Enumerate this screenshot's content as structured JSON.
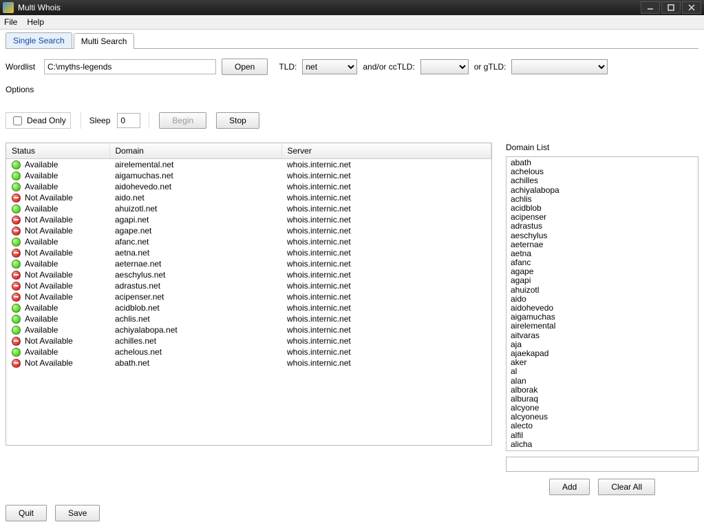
{
  "window": {
    "title": "Multi Whois"
  },
  "menu": {
    "file": "File",
    "help": "Help"
  },
  "tabs": {
    "single": "Single Search",
    "multi": "Multi Search"
  },
  "wordlist": {
    "label": "Wordlist",
    "value": "C:\\myths-legends",
    "open": "Open"
  },
  "tld": {
    "label": "TLD:",
    "value": "net",
    "cc_label": "and/or ccTLD:",
    "cc_value": "",
    "g_label": "or gTLD:",
    "g_value": ""
  },
  "options": {
    "label": "Options",
    "deadonly": "Dead Only",
    "sleep_label": "Sleep",
    "sleep_value": "0",
    "begin": "Begin",
    "stop": "Stop"
  },
  "columns": {
    "status": "Status",
    "domain": "Domain",
    "server": "Server"
  },
  "status_text": {
    "available": "Available",
    "not_available": "Not Available"
  },
  "results": [
    {
      "available": true,
      "domain": "airelemental.net",
      "server": "whois.internic.net"
    },
    {
      "available": true,
      "domain": "aigamuchas.net",
      "server": "whois.internic.net"
    },
    {
      "available": true,
      "domain": "aidohevedo.net",
      "server": "whois.internic.net"
    },
    {
      "available": false,
      "domain": "aido.net",
      "server": "whois.internic.net"
    },
    {
      "available": true,
      "domain": "ahuizotl.net",
      "server": "whois.internic.net"
    },
    {
      "available": false,
      "domain": "agapi.net",
      "server": "whois.internic.net"
    },
    {
      "available": false,
      "domain": "agape.net",
      "server": "whois.internic.net"
    },
    {
      "available": true,
      "domain": "afanc.net",
      "server": "whois.internic.net"
    },
    {
      "available": false,
      "domain": "aetna.net",
      "server": "whois.internic.net"
    },
    {
      "available": true,
      "domain": "aeternae.net",
      "server": "whois.internic.net"
    },
    {
      "available": false,
      "domain": "aeschylus.net",
      "server": "whois.internic.net"
    },
    {
      "available": false,
      "domain": "adrastus.net",
      "server": "whois.internic.net"
    },
    {
      "available": false,
      "domain": "acipenser.net",
      "server": "whois.internic.net"
    },
    {
      "available": true,
      "domain": "acidblob.net",
      "server": "whois.internic.net"
    },
    {
      "available": true,
      "domain": "achlis.net",
      "server": "whois.internic.net"
    },
    {
      "available": true,
      "domain": "achiyalabopa.net",
      "server": "whois.internic.net"
    },
    {
      "available": false,
      "domain": "achilles.net",
      "server": "whois.internic.net"
    },
    {
      "available": true,
      "domain": "achelous.net",
      "server": "whois.internic.net"
    },
    {
      "available": false,
      "domain": "abath.net",
      "server": "whois.internic.net"
    }
  ],
  "domain_list": {
    "label": "Domain List",
    "items": [
      "abath",
      "achelous",
      "achilles",
      "achiyalabopa",
      "achlis",
      "acidblob",
      "acipenser",
      "adrastus",
      "aeschylus",
      "aeternae",
      "aetna",
      "afanc",
      "agape",
      "agapi",
      "ahuizotl",
      "aido",
      "aidohevedo",
      "aigamuchas",
      "airelemental",
      "aitvaras",
      "aja",
      "ajaekapad",
      "aker",
      "al",
      "alan",
      "alborak",
      "alburaq",
      "alcyone",
      "alcyoneus",
      "alecto",
      "alfil",
      "alicha"
    ],
    "input_value": "",
    "add": "Add",
    "clear": "Clear All"
  },
  "footer": {
    "quit": "Quit",
    "save": "Save"
  }
}
